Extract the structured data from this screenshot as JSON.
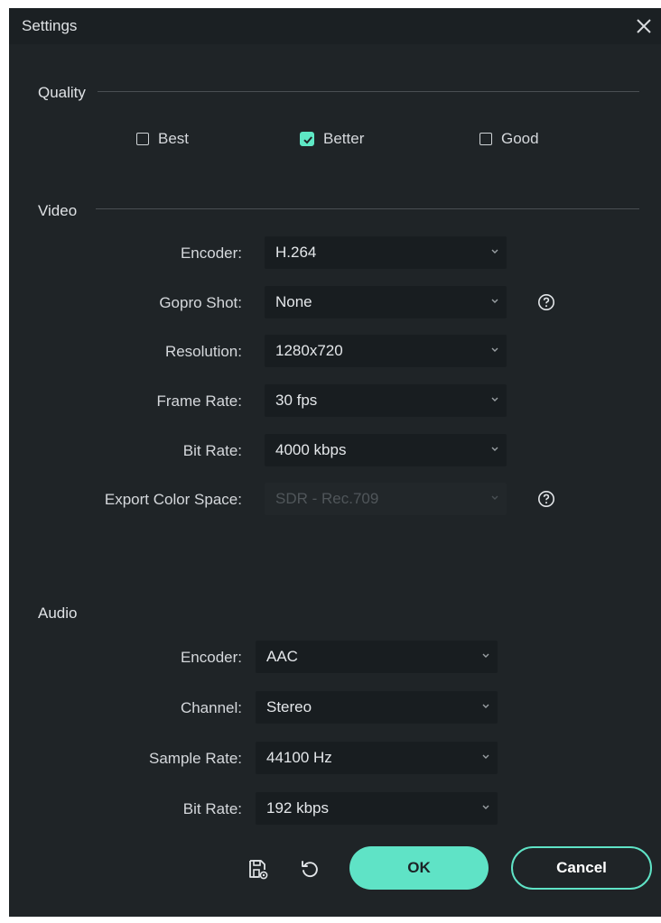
{
  "window": {
    "title": "Settings"
  },
  "quality": {
    "label": "Quality",
    "options": [
      {
        "label": "Best",
        "checked": false
      },
      {
        "label": "Better",
        "checked": true
      },
      {
        "label": "Good",
        "checked": false
      }
    ]
  },
  "video": {
    "label": "Video",
    "encoder": {
      "label": "Encoder:",
      "value": "H.264"
    },
    "gopro": {
      "label": "Gopro Shot:",
      "value": "None"
    },
    "resolution": {
      "label": "Resolution:",
      "value": "1280x720"
    },
    "frame_rate": {
      "label": "Frame Rate:",
      "value": "30 fps"
    },
    "bit_rate": {
      "label": "Bit Rate:",
      "value": "4000 kbps"
    },
    "color_space": {
      "label": "Export Color Space:",
      "value": "SDR - Rec.709",
      "disabled": true
    }
  },
  "audio": {
    "label": "Audio",
    "encoder": {
      "label": "Encoder:",
      "value": "AAC"
    },
    "channel": {
      "label": "Channel:",
      "value": "Stereo"
    },
    "sample_rate": {
      "label": "Sample Rate:",
      "value": "44100 Hz"
    },
    "bit_rate": {
      "label": "Bit Rate:",
      "value": "192 kbps"
    }
  },
  "footer": {
    "ok_label": "OK",
    "cancel_label": "Cancel"
  },
  "colors": {
    "accent": "#5fe3c6",
    "background": "#1f2427",
    "field": "#181d20"
  }
}
